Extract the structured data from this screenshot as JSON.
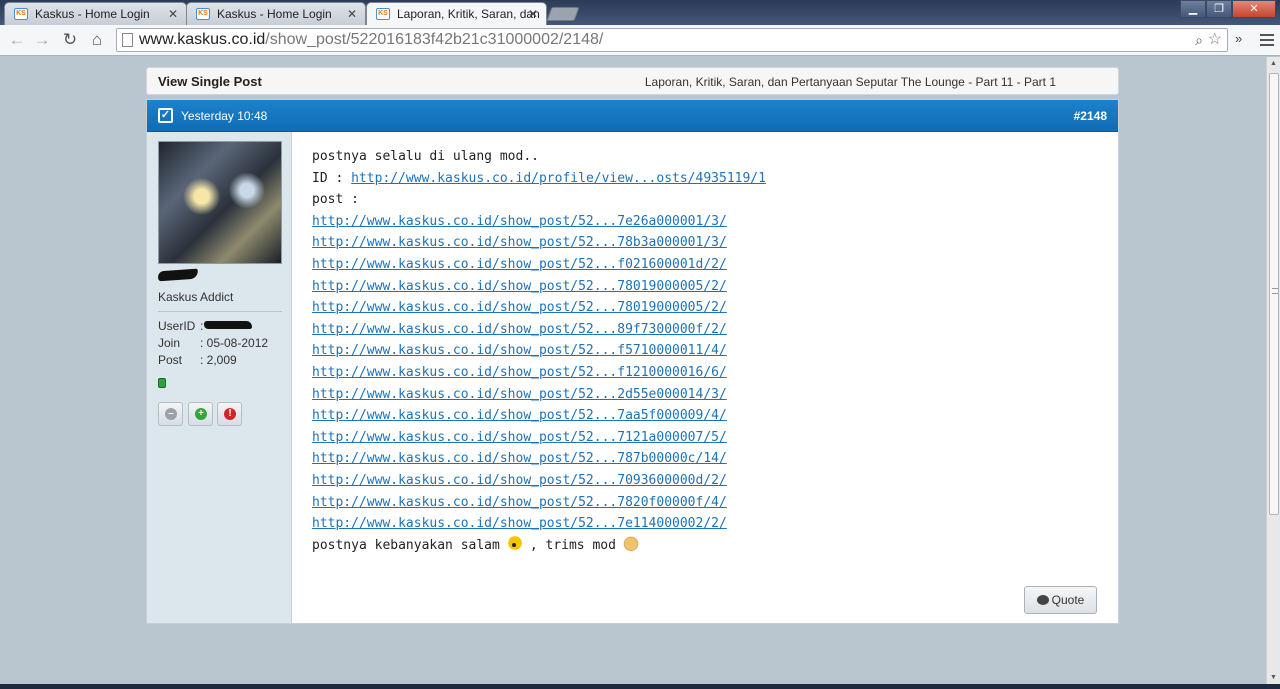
{
  "browser": {
    "tabs": [
      {
        "title": "Kaskus - Home Login",
        "favicon": "kaskus-favicon"
      },
      {
        "title": "Kaskus - Home Login",
        "favicon": "kaskus-favicon"
      },
      {
        "title": "Laporan, Kritik, Saran, dan",
        "favicon": "kaskus-favicon",
        "active": true
      }
    ],
    "tab_close_glyph": "✕",
    "url_domain": "www.kaskus.co.id",
    "url_path": "/show_post/522016183f42b21c31000002/2148/"
  },
  "page": {
    "header_title": "View Single Post",
    "thread_title": "Laporan, Kritik, Saran, dan Pertanyaan Seputar The Lounge - Part 11 - Part 1"
  },
  "post": {
    "timestamp": "Yesterday 10:48",
    "number": "#2148",
    "author": {
      "rank": "Kaskus Addict",
      "userid_label": "UserID",
      "userid_value": ":",
      "join_label": "Join",
      "join_value": ": 05-08-2012",
      "post_label": "Post",
      "post_value": ": 2,009",
      "online_color": "#2ea33b"
    },
    "body": {
      "intro": "postnya selalu di ulang mod..",
      "id_label": "ID : ",
      "id_link": "http://www.kaskus.co.id/profile/view...osts/4935119/1",
      "post_label": "post :",
      "links": [
        "http://www.kaskus.co.id/show_post/52...7e26a000001/3/",
        "http://www.kaskus.co.id/show_post/52...78b3a000001/3/",
        "http://www.kaskus.co.id/show_post/52...f021600001d/2/",
        "http://www.kaskus.co.id/show_post/52...78019000005/2/",
        "http://www.kaskus.co.id/show_post/52...78019000005/2/",
        "http://www.kaskus.co.id/show_post/52...89f7300000f/2/",
        "http://www.kaskus.co.id/show_post/52...f5710000011/4/",
        "http://www.kaskus.co.id/show_post/52...f1210000016/6/",
        "http://www.kaskus.co.id/show_post/52...2d55e000014/3/",
        "http://www.kaskus.co.id/show_post/52...7aa5f000009/4/",
        "http://www.kaskus.co.id/show_post/52...7121a000007/5/",
        "http://www.kaskus.co.id/show_post/52...787b00000c/14/",
        "http://www.kaskus.co.id/show_post/52...7093600000d/2/",
        "http://www.kaskus.co.id/show_post/52...7820f00000f/4/",
        "http://www.kaskus.co.id/show_post/52...7e114000002/2/"
      ],
      "closing_part1": "postnya kebanyakan salam",
      "closing_part2": ", trims mod"
    },
    "quote_label": "Quote"
  },
  "colors": {
    "post_header": "#1576c2",
    "link": "#1e72b8",
    "page_bg": "#b9c5cf"
  }
}
